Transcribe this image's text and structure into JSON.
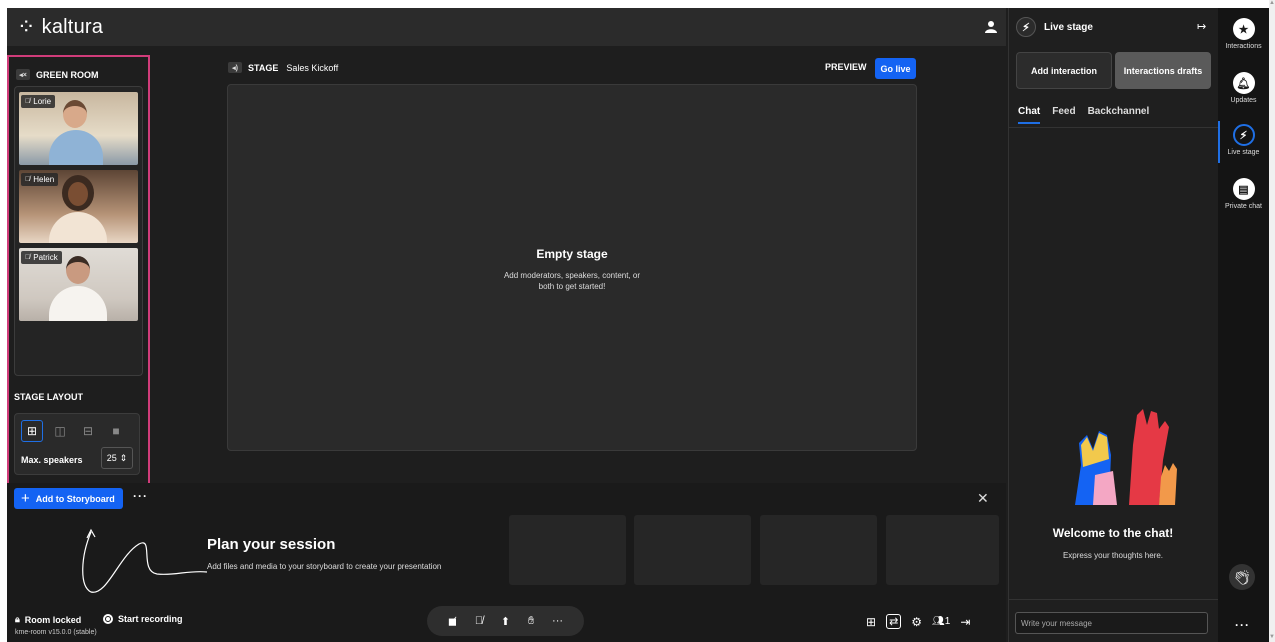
{
  "brand": {
    "logo_text": "kaltura",
    "logo_mark": "⁘"
  },
  "green_room": {
    "title": "GREEN ROOM",
    "participants": [
      {
        "name": "Lorie"
      },
      {
        "name": "Helen"
      },
      {
        "name": "Patrick"
      }
    ]
  },
  "stage_layout": {
    "title": "STAGE LAYOUT",
    "max_speakers_label": "Max. speakers",
    "max_speakers_value": "25"
  },
  "stage": {
    "label": "STAGE",
    "session_name": "Sales Kickoff",
    "preview_label": "PREVIEW",
    "go_live_label": "Go live",
    "empty_title": "Empty stage",
    "empty_line1": "Add moderators, speakers, content, or",
    "empty_line2": "both to get started!"
  },
  "storyboard": {
    "add_label": "Add to Storyboard",
    "plan_title": "Plan your session",
    "plan_sub": "Add files and media to your storyboard to create your presentation"
  },
  "bottom_bar": {
    "room_locked": "Room locked",
    "start_recording": "Start recording",
    "version": "kme-room v15.0.0 (stable)",
    "participant_count": "1"
  },
  "right_panel": {
    "title": "Live stage",
    "add_interaction": "Add interaction",
    "interactions_drafts": "Interactions drafts",
    "tabs": [
      {
        "label": "Chat"
      },
      {
        "label": "Feed"
      },
      {
        "label": "Backchannel"
      }
    ],
    "welcome_title": "Welcome to the chat!",
    "welcome_sub": "Express your thoughts here.",
    "input_placeholder": "Write your message"
  },
  "sidebar": {
    "items": [
      {
        "label": "Interactions",
        "icon": "star-icon"
      },
      {
        "label": "Updates",
        "icon": "bell-icon"
      },
      {
        "label": "Live stage",
        "icon": "bolt-icon"
      },
      {
        "label": "Private chat",
        "icon": "chat-bubble-icon"
      }
    ]
  },
  "colors": {
    "accent": "#1463f3",
    "green_room_border": "#d13c7a",
    "background": "#1e1e1e"
  }
}
